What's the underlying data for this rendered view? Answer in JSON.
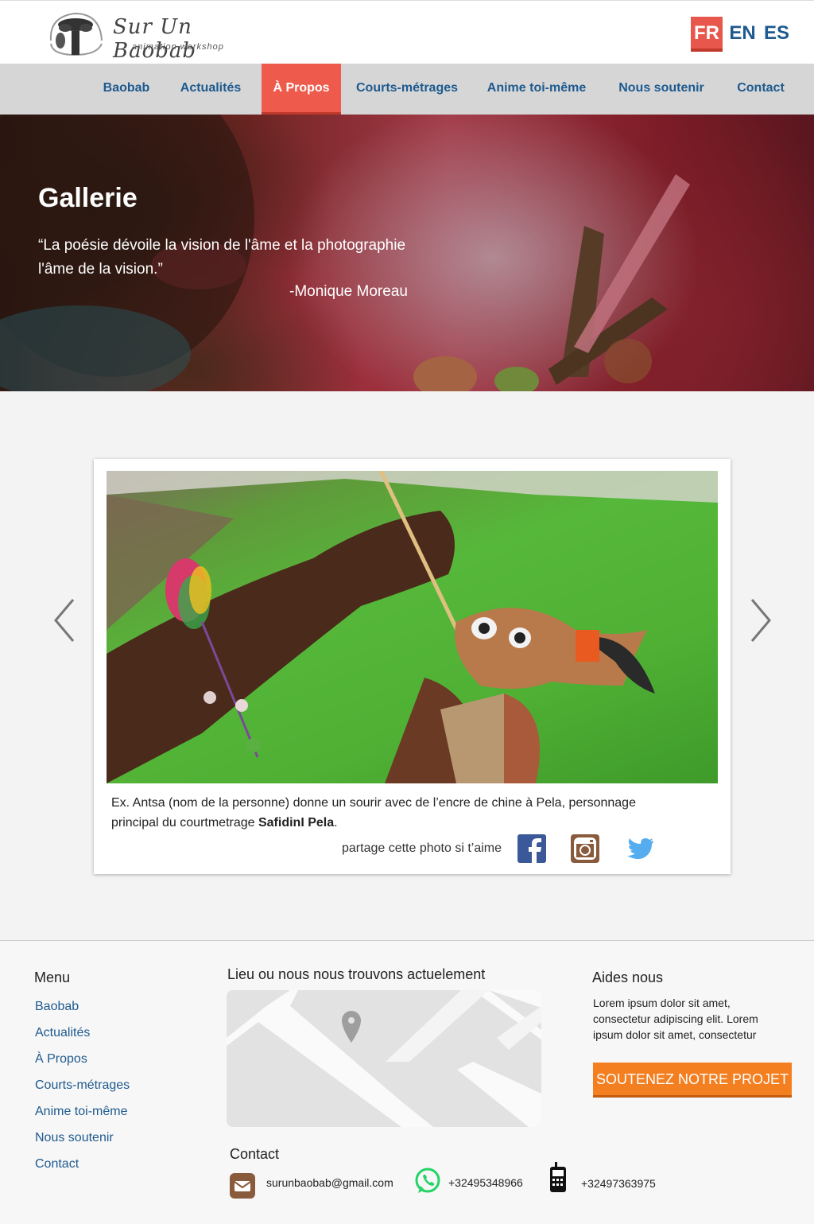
{
  "brand": {
    "name": "Sur Un Baobab",
    "tagline": "animation workshop"
  },
  "languages": [
    {
      "code": "FR",
      "active": true
    },
    {
      "code": "EN",
      "active": false
    },
    {
      "code": "ES",
      "active": false
    }
  ],
  "nav": {
    "items": [
      {
        "label": "Baobab"
      },
      {
        "label": "Actualités"
      },
      {
        "label": "À Propos",
        "active": true
      },
      {
        "label": "Courts-métrages"
      },
      {
        "label": "Anime toi-même"
      },
      {
        "label": "Nous soutenir"
      },
      {
        "label": "Contact"
      }
    ]
  },
  "hero": {
    "title": "Gallerie",
    "quote_open": "“",
    "quote": "La poésie dévoile la vision de l'âme et la photographie l'âme de la vision.",
    "quote_close": "”",
    "author": "-Monique Moreau"
  },
  "gallery": {
    "caption_main": "Ex. Antsa (nom de la personne) donne un sourir avec de l’encre de chine à Pela, personnage principal du courtmetrage ",
    "caption_bold": "SafidinI Pela",
    "caption_end": ".",
    "share_label": "partage cette photo si t’aime",
    "social": [
      "facebook-icon",
      "instagram-icon",
      "twitter-icon"
    ]
  },
  "footer": {
    "menu_title": "Menu",
    "menu_items": [
      "Baobab",
      "Actualités",
      "À Propos",
      "Courts-métrages",
      "Anime toi-même",
      "Nous soutenir",
      "Contact"
    ],
    "location_title": "Lieu ou nous nous trouvons actuelement",
    "help_title": "Aides nous",
    "help_text": "Lorem ipsum dolor sit amet, consectetur adipiscing elit. Lorem ipsum dolor sit amet, consectetur",
    "cta_label": "SOUTENEZ NOTRE PROJET",
    "contact_title": "Contact",
    "email": "surunbaobab@gmail.com",
    "whatsapp": "+32495348966",
    "phone": "+32497363975"
  },
  "colors": {
    "accent_red": "#ee5b4c",
    "link_blue": "#1e5a8f",
    "cta_orange": "#f47f21",
    "facebook": "#3b5998",
    "instagram": "#8a5a3c",
    "twitter": "#55acee",
    "whatsapp": "#25d366"
  }
}
